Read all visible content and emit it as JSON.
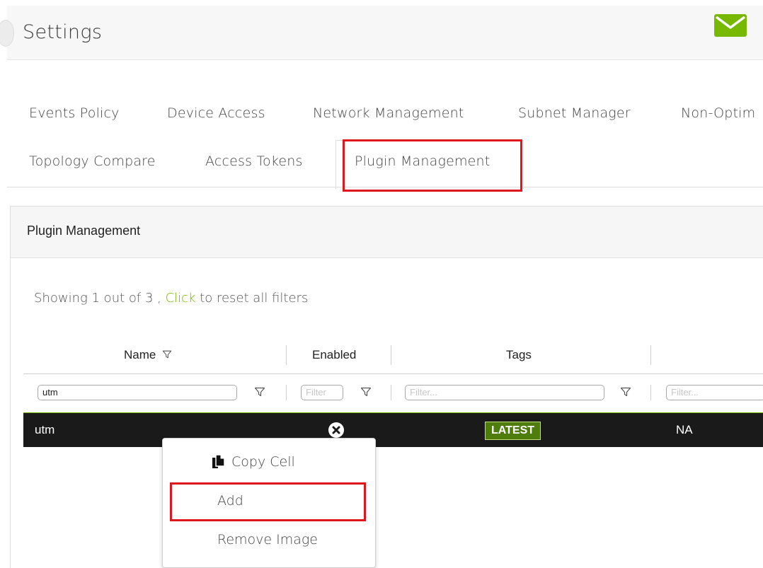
{
  "header": {
    "title": "Settings",
    "mail_icon": "envelope-icon",
    "mail_color": "#76b900"
  },
  "tabs": {
    "row1": [
      "Events Policy",
      "Device Access",
      "Network Management",
      "Subnet Manager",
      "Non-Optim"
    ],
    "row2": [
      "Topology Compare",
      "Access Tokens",
      "Plugin Management"
    ],
    "active": "Plugin Management"
  },
  "panel": {
    "title": "Plugin Management",
    "showing_prefix": "Showing 1 out of 3 , ",
    "reset_link": "Click",
    "showing_suffix": " to reset all filters"
  },
  "table": {
    "columns": [
      "Name",
      "Enabled",
      "Tags"
    ],
    "filters": {
      "name_value": "utm",
      "enabled_placeholder": "Filter",
      "tags_placeholder": "Filter...",
      "col4_placeholder": "Filter..."
    },
    "rows": [
      {
        "name": "utm",
        "enabled_icon": "x-circle-icon",
        "tag": "LATEST",
        "col4": "NA"
      }
    ]
  },
  "context_menu": {
    "items": [
      "Copy Cell",
      "Add",
      "Remove Image"
    ],
    "copy_icon": "copy-icon"
  },
  "colors": {
    "accent": "#76b900",
    "highlight": "#e0161f",
    "row_bg": "#1a1a1a"
  }
}
